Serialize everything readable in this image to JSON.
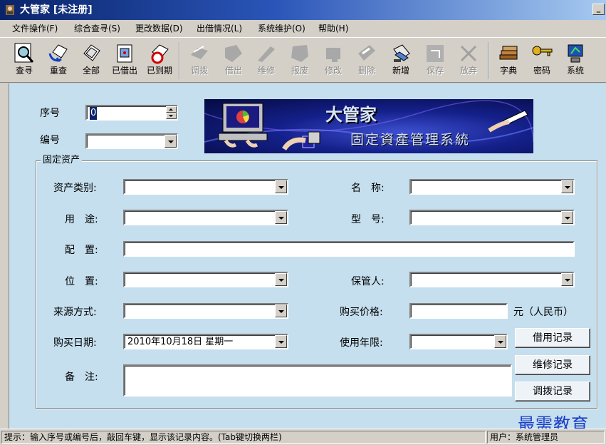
{
  "window": {
    "title": "大管家 [未注册]",
    "min_glyph": "_"
  },
  "menu": [
    {
      "label": "文件操作(F)"
    },
    {
      "label": "综合查寻(S)"
    },
    {
      "label": "更改数据(D)"
    },
    {
      "label": "出借情况(L)"
    },
    {
      "label": "系统维护(O)"
    },
    {
      "label": "帮助(H)"
    }
  ],
  "toolbar": [
    {
      "label": "查寻",
      "icon": "search-icon",
      "enabled": true
    },
    {
      "label": "重查",
      "icon": "requery-icon",
      "enabled": true
    },
    {
      "label": "全部",
      "icon": "all-icon",
      "enabled": true
    },
    {
      "label": "已借出",
      "icon": "lent-icon",
      "enabled": true
    },
    {
      "label": "已到期",
      "icon": "expired-icon",
      "enabled": true
    },
    {
      "label": "调拨",
      "icon": "transfer-icon",
      "enabled": false
    },
    {
      "label": "借出",
      "icon": "lend-icon",
      "enabled": false
    },
    {
      "label": "维修",
      "icon": "repair-icon",
      "enabled": false
    },
    {
      "label": "报废",
      "icon": "scrap-icon",
      "enabled": false
    },
    {
      "label": "修改",
      "icon": "edit-icon",
      "enabled": false
    },
    {
      "label": "删除",
      "icon": "delete-icon",
      "enabled": false
    },
    {
      "label": "新增",
      "icon": "new-icon",
      "enabled": true
    },
    {
      "label": "保存",
      "icon": "save-icon",
      "enabled": false
    },
    {
      "label": "放弃",
      "icon": "discard-icon",
      "enabled": false
    },
    {
      "label": "字典",
      "icon": "dictionary-icon",
      "enabled": true
    },
    {
      "label": "密码",
      "icon": "key-icon",
      "enabled": true
    },
    {
      "label": "系统",
      "icon": "system-icon",
      "enabled": true
    }
  ],
  "form": {
    "serial_label": "序号",
    "serial_value": "0",
    "code_label": "编号",
    "code_value": "",
    "group_title": "固定资产",
    "category_label": "资产类别:",
    "name_label": "名　称:",
    "usage_label": "用　途:",
    "model_label": "型　号:",
    "config_label": "配　置:",
    "location_label": "位　置:",
    "keeper_label": "保管人:",
    "source_label": "来源方式:",
    "price_label": "购买价格:",
    "price_unit": "元（人民币）",
    "date_label": "购买日期:",
    "date_value": "2010年10月18日 星期一",
    "life_label": "使用年限:",
    "remark_label": "备　注:"
  },
  "buttons": {
    "borrow_record": "借用记录",
    "repair_record": "维修记录",
    "transfer_record": "调拨记录"
  },
  "banner": {
    "title": "大管家",
    "subtitle": "固定資產管理系統"
  },
  "status": {
    "hint": "提示：输入序号或编号后，敲回车键，显示该记录内容。(Tab键切换两栏)",
    "user": "用户：系统管理员"
  },
  "watermark": "最需教育",
  "colors": {
    "panel": "#c5dfee",
    "titlebar": "#0a246a",
    "chrome": "#d4d0c8"
  }
}
